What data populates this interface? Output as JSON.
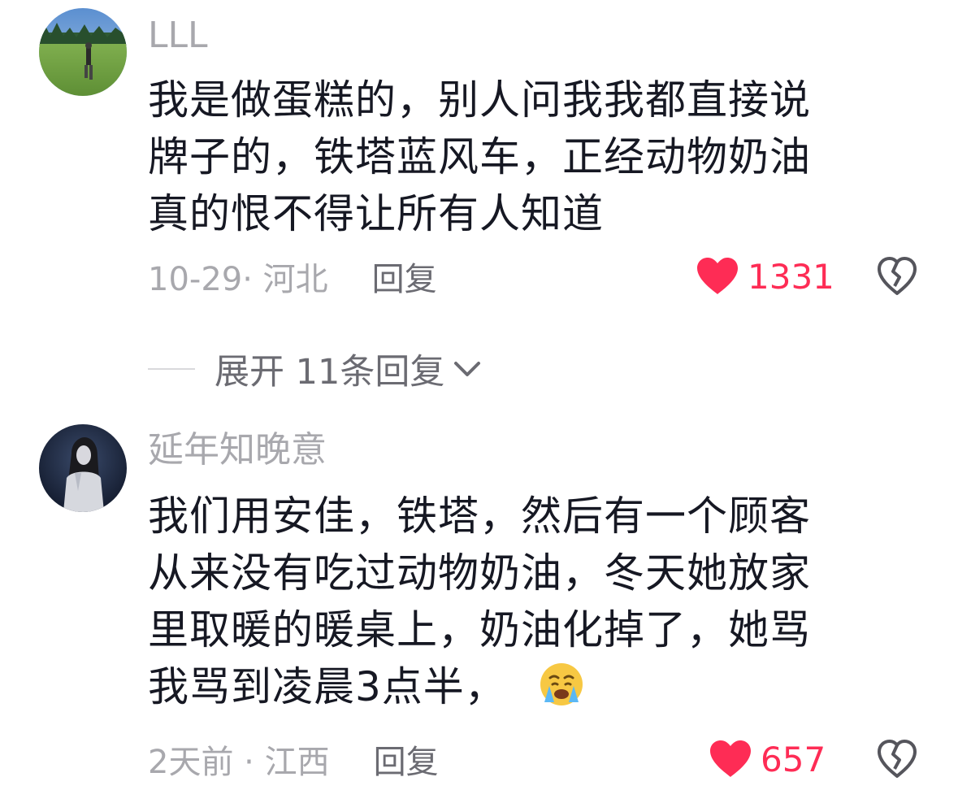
{
  "comments": [
    {
      "username": "LLL",
      "lines": [
        "我是做蛋糕的，别人问我我都直接说",
        "牌子的，铁塔蓝风车，正经动物奶油",
        "真的恨不得让所有人知道"
      ],
      "meta": "10-29· 河北",
      "reply_label": "回复",
      "likes": "1331",
      "avatar_icon": "meadow-photo-avatar"
    },
    {
      "username": "延年知晚意",
      "lines": [
        "我们用安佳，铁塔，然后有一个顾客",
        "从来没有吃过动物奶油，冬天她放家",
        "里取暖的暖桌上，奶油化掉了，她骂",
        "我骂到凌晨3点半，"
      ],
      "emoji": "crying-face-emoji",
      "meta": "2天前 · 江西",
      "reply_label": "回复",
      "likes": "657",
      "avatar_icon": "night-portrait-avatar"
    }
  ],
  "expand_replies": {
    "label": "展开 11条回复"
  },
  "colors": {
    "text": "#161823",
    "muted": "#a8a8ad",
    "secondary": "#6b6b72",
    "like": "#fe2c55"
  }
}
